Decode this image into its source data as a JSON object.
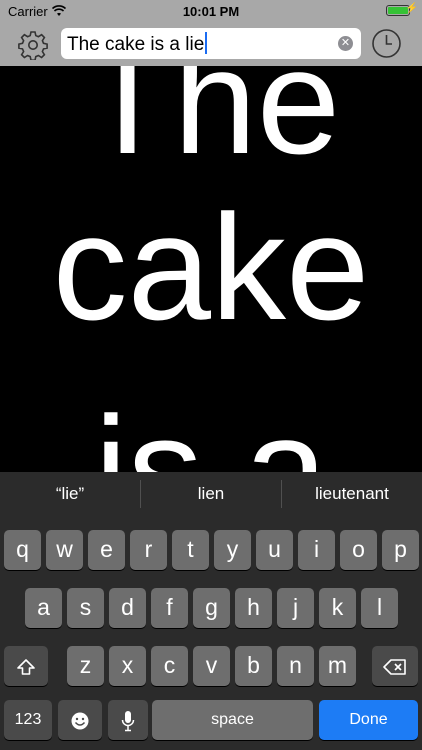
{
  "status": {
    "carrier": "Carrier",
    "time": "10:01 PM"
  },
  "toolbar": {
    "search_value": "The cake is a lie",
    "settings_icon": "gear-icon",
    "history_icon": "clock-icon",
    "clear_icon": "clear-icon"
  },
  "display": {
    "line1": "The",
    "line2": "cake",
    "line3": "is a"
  },
  "suggestions": [
    "“lie”",
    "lien",
    "lieutenant"
  ],
  "keyboard": {
    "row1": [
      "q",
      "w",
      "e",
      "r",
      "t",
      "y",
      "u",
      "i",
      "o",
      "p"
    ],
    "row2": [
      "a",
      "s",
      "d",
      "f",
      "g",
      "h",
      "j",
      "k",
      "l"
    ],
    "row3": [
      "z",
      "x",
      "c",
      "v",
      "b",
      "n",
      "m"
    ],
    "numbers_label": "123",
    "space_label": "space",
    "done_label": "Done"
  },
  "colors": {
    "toolbar_bg": "#a8a8a8",
    "done_blue": "#1d7cf5",
    "keyboard_bg": "#2b2b2b"
  }
}
